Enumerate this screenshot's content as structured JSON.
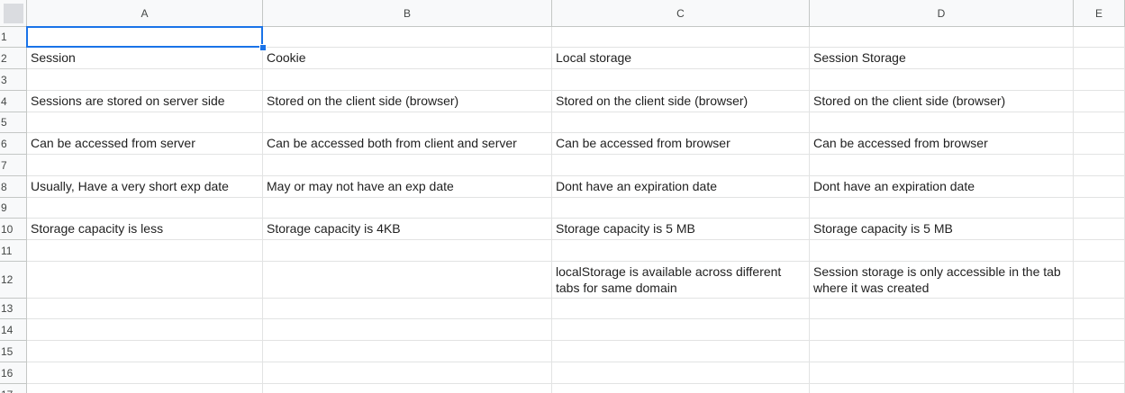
{
  "columns": [
    "A",
    "B",
    "C",
    "D",
    "E"
  ],
  "rows": [
    "1",
    "2",
    "3",
    "4",
    "5",
    "6",
    "7",
    "8",
    "9",
    "10",
    "11",
    "12",
    "13",
    "14",
    "15",
    "16",
    "17"
  ],
  "cells": {
    "r2": {
      "A": "Session",
      "B": "Cookie",
      "C": "Local storage",
      "D": "Session Storage"
    },
    "r4": {
      "A": "Sessions are stored on server side",
      "B": "Stored on the client side (browser)",
      "C": "Stored on the client side (browser)",
      "D": "Stored on the client side (browser)"
    },
    "r6": {
      "A": "Can be accessed from server",
      "B": "Can be accessed both from client and server",
      "C": "Can be accessed from browser",
      "D": "Can be accessed from browser"
    },
    "r8": {
      "A": "Usually, Have a very short exp date",
      "B": "May or may not have an exp date",
      "C": "Dont have an expiration date",
      "D": "Dont have an expiration date"
    },
    "r10": {
      "A": "Storage capacity is less",
      "B": "Storage capacity is 4KB",
      "C": "Storage capacity is 5 MB",
      "D": "Storage capacity is 5 MB"
    },
    "r12": {
      "A": "",
      "B": "",
      "C": "localStorage is available across different tabs for same domain",
      "D": "Session storage is only accessible in the tab where it was created"
    }
  },
  "selected_cell": "A1",
  "colors": {
    "selection": "#1a73e8",
    "header_bg": "#f8f9fa",
    "gridline": "#e2e3e3"
  }
}
